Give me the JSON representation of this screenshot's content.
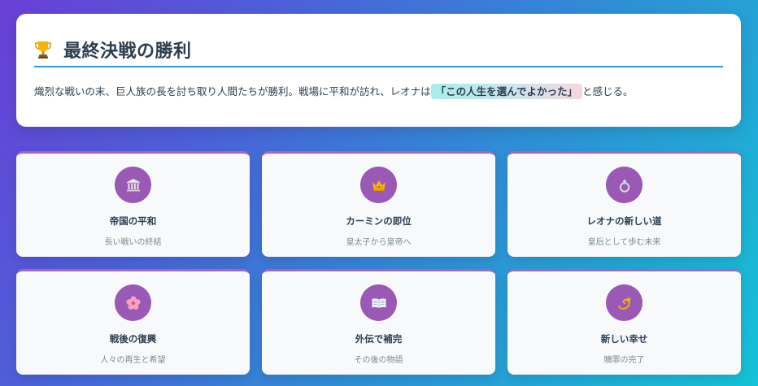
{
  "header": {
    "title": "最終決戦の勝利",
    "icon": "trophy-icon",
    "description_before": "熾烈な戦いの末、巨人族の長を討ち取り人間たちが勝利。戦場に平和が訪れ、レオナは",
    "description_highlight": "「この人生を選んでよかった」",
    "description_after": "と感じる。"
  },
  "colors": {
    "accent_blue": "#3498db",
    "icon_circle_purple": "#9b59b6",
    "title_text": "#2c3e50"
  },
  "cards": [
    {
      "icon": "temple-icon",
      "title": "帝国の平和",
      "subtitle": "長い戦いの終結"
    },
    {
      "icon": "crown-icon",
      "title": "カーミンの即位",
      "subtitle": "皇太子から皇帝へ"
    },
    {
      "icon": "ring-icon",
      "title": "レオナの新しい道",
      "subtitle": "皇后として歩む未来"
    },
    {
      "icon": "blossom-icon",
      "title": "戦後の復興",
      "subtitle": "人々の再生と希望"
    },
    {
      "icon": "open-book-icon",
      "title": "外伝で補完",
      "subtitle": "その後の物語"
    },
    {
      "icon": "dizzy-star-icon",
      "title": "新しい幸せ",
      "subtitle": "贖罪の完了"
    }
  ]
}
